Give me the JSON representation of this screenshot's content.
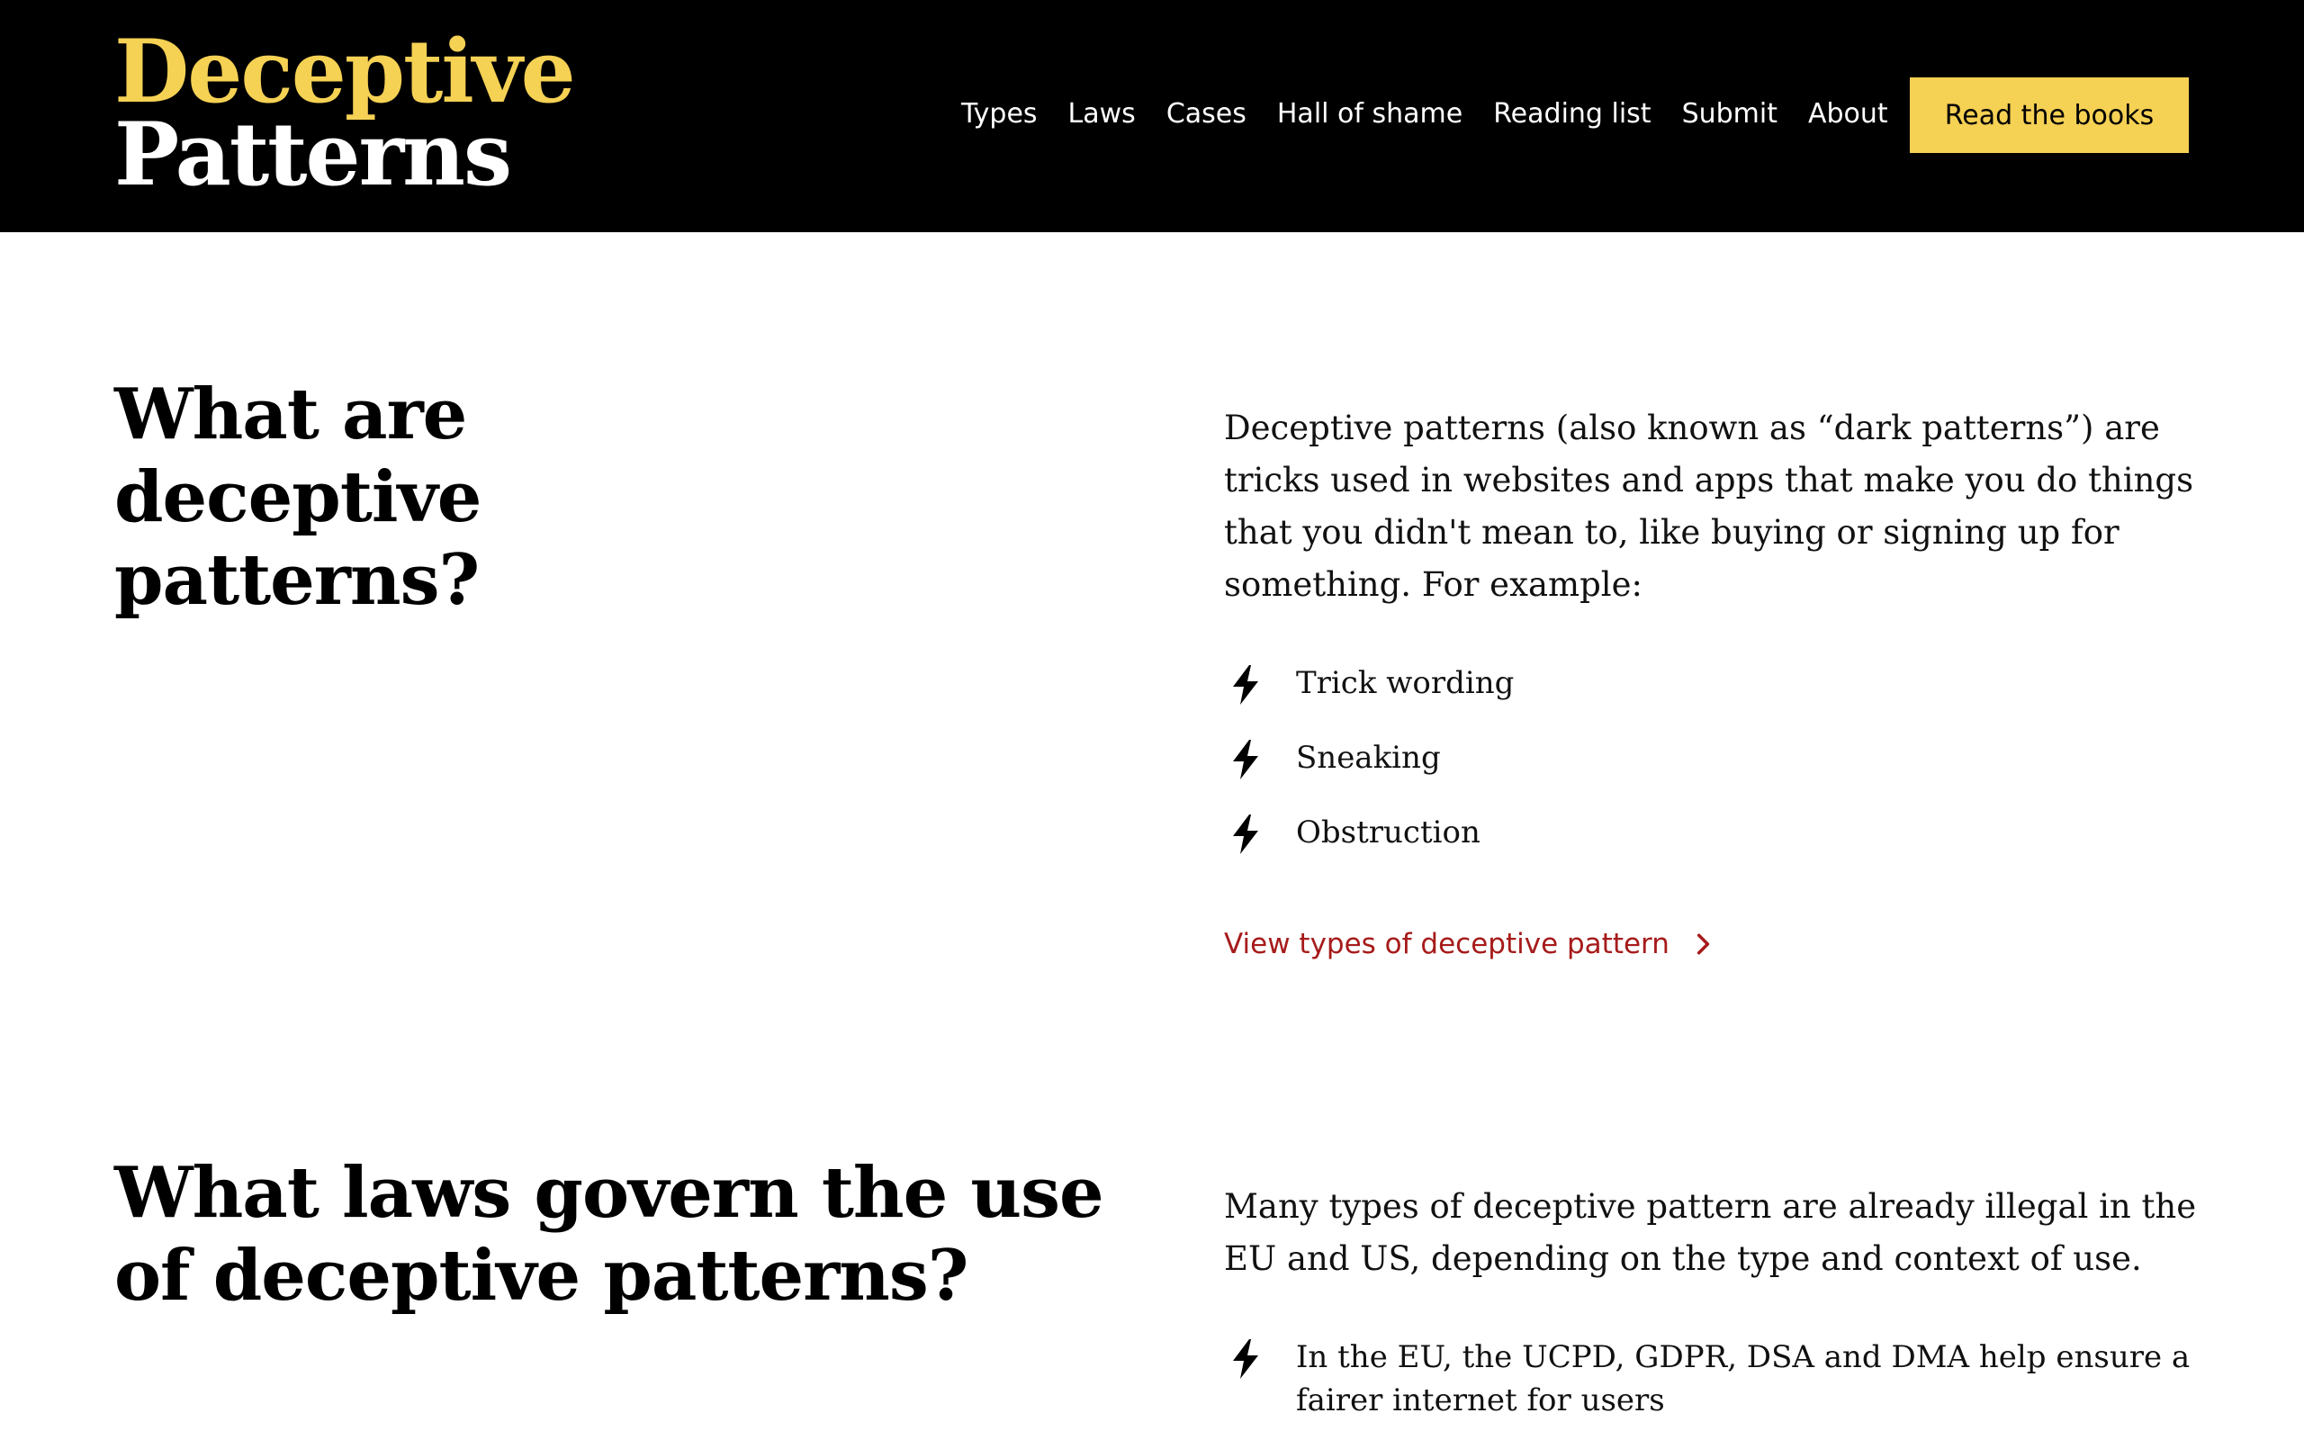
{
  "colors": {
    "header_bg": "#000000",
    "brand_yellow": "#f5d154",
    "link_red": "#a61b1b",
    "text": "#111111"
  },
  "header": {
    "logo_line1": "Deceptive",
    "logo_line2": "Patterns",
    "nav": [
      {
        "label": "Types"
      },
      {
        "label": "Laws"
      },
      {
        "label": "Cases"
      },
      {
        "label": "Hall of shame"
      },
      {
        "label": "Reading list"
      },
      {
        "label": "Submit"
      },
      {
        "label": "About"
      }
    ],
    "cta_label": "Read the books"
  },
  "sections": [
    {
      "heading": "What are deceptive patterns?",
      "lede": "Deceptive patterns (also known as “dark patterns”) are tricks used in websites and apps that make you do things that you didn't mean to, like buying or signing up for something. For example:",
      "bullets": [
        "Trick wording",
        "Sneaking",
        "Obstruction"
      ],
      "link_label": "View types of deceptive pattern",
      "bullet_icon": "lightning-bolt-icon",
      "link_icon": "chevron-right-icon"
    },
    {
      "heading": "What laws govern the use of deceptive patterns?",
      "lede": "Many types of deceptive pattern are already illegal in the EU and US, depending on the type and context of use.",
      "bullets": [
        "In the EU, the UCPD, GDPR, DSA and DMA help ensure a fairer internet for users"
      ],
      "bullet_icon": "lightning-bolt-icon"
    }
  ]
}
